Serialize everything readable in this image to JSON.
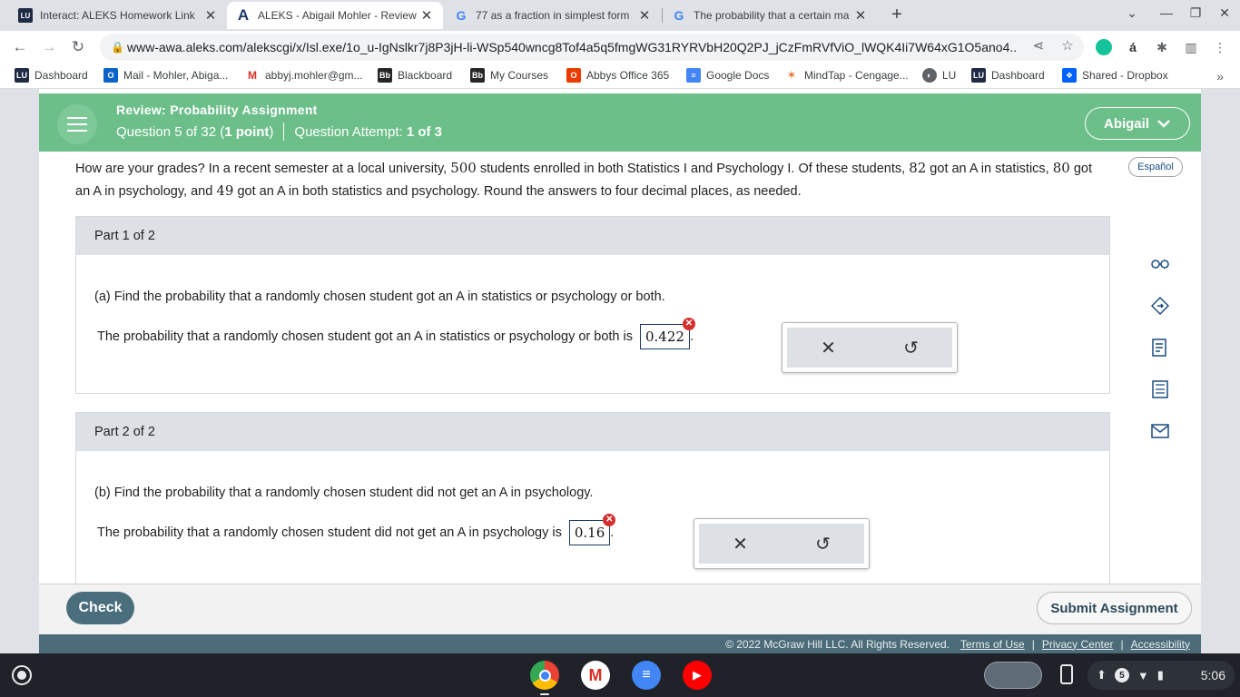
{
  "browser": {
    "tabs": [
      {
        "title": "Interact: ALEKS Homework Link",
        "favicon": "lu-icon"
      },
      {
        "title": "ALEKS - Abigail Mohler - Review",
        "favicon": "aleks-icon"
      },
      {
        "title": "77 as a fraction in simplest form",
        "favicon": "google-icon"
      },
      {
        "title": "The probability that a certain ma",
        "favicon": "google-icon"
      }
    ],
    "url": "www-awa.aleks.com/alekscgi/x/Isl.exe/1o_u-IgNslkr7j8P3jH-li-WSp540wncg8Tof4a5q5fmgWG31RYRVbH20Q2PJ_jCzFmRVfViO_lWQK4Ii7W64xG1O5ano4...",
    "bookmarks": [
      {
        "label": "Dashboard"
      },
      {
        "label": "Mail - Mohler, Abiga..."
      },
      {
        "label": "abbyj.mohler@gm..."
      },
      {
        "label": "Blackboard"
      },
      {
        "label": "My Courses"
      },
      {
        "label": "Abbys Office 365"
      },
      {
        "label": "Google Docs"
      },
      {
        "label": "MindTap - Cengage..."
      },
      {
        "label": "LU"
      },
      {
        "label": "Dashboard"
      },
      {
        "label": "Shared - Dropbox"
      }
    ]
  },
  "header": {
    "assignment_title": "Review: Probability Assignment",
    "question_prefix": "Question 5 of 32 (",
    "question_points": "1 point",
    "question_suffix": ")",
    "attempt_label": "Question Attempt: ",
    "attempt_value": "1 of 3",
    "user_name": "Abigail"
  },
  "problem": {
    "espanol": "Español",
    "t1": "How are your grades? In a recent semester at a local university, ",
    "n1": "500",
    "t2": " students enrolled in both Statistics I and Psychology I. Of these students, ",
    "n2": "82",
    "t3": " got an A in statistics, ",
    "n3": "80",
    "t4": " got an A in psychology, and ",
    "n4": "49",
    "t5": " got an A in both statistics and psychology. Round the answers to four decimal places, as needed."
  },
  "parts": [
    {
      "header": "Part 1 of 2",
      "question": "(a) Find the probability that a randomly chosen student got an A in statistics or psychology or both.",
      "answer_prompt": "The probability that a randomly chosen student got an A in statistics or psychology or both is",
      "answer_value": "0.422",
      "period": "."
    },
    {
      "header": "Part 2 of 2",
      "question": "(b) Find the probability that a randomly chosen student did not get an A in psychology.",
      "answer_prompt": "The probability that a randomly chosen student did not get an A in psychology is",
      "answer_value": "0.16",
      "period": "."
    }
  ],
  "footer": {
    "check_label": "Check",
    "submit_label": "Submit Assignment",
    "copyright": "© 2022 McGraw Hill LLC. All Rights Reserved.",
    "terms": "Terms of Use",
    "privacy": "Privacy Center",
    "accessibility": "Accessibility"
  },
  "taskbar": {
    "notification_count": "5",
    "time": "5:06"
  },
  "colors": {
    "header_green": "#6dbf8a",
    "footer_teal": "#4b6b78",
    "check_button": "#4a6e7c",
    "error_red": "#d32f2f"
  }
}
